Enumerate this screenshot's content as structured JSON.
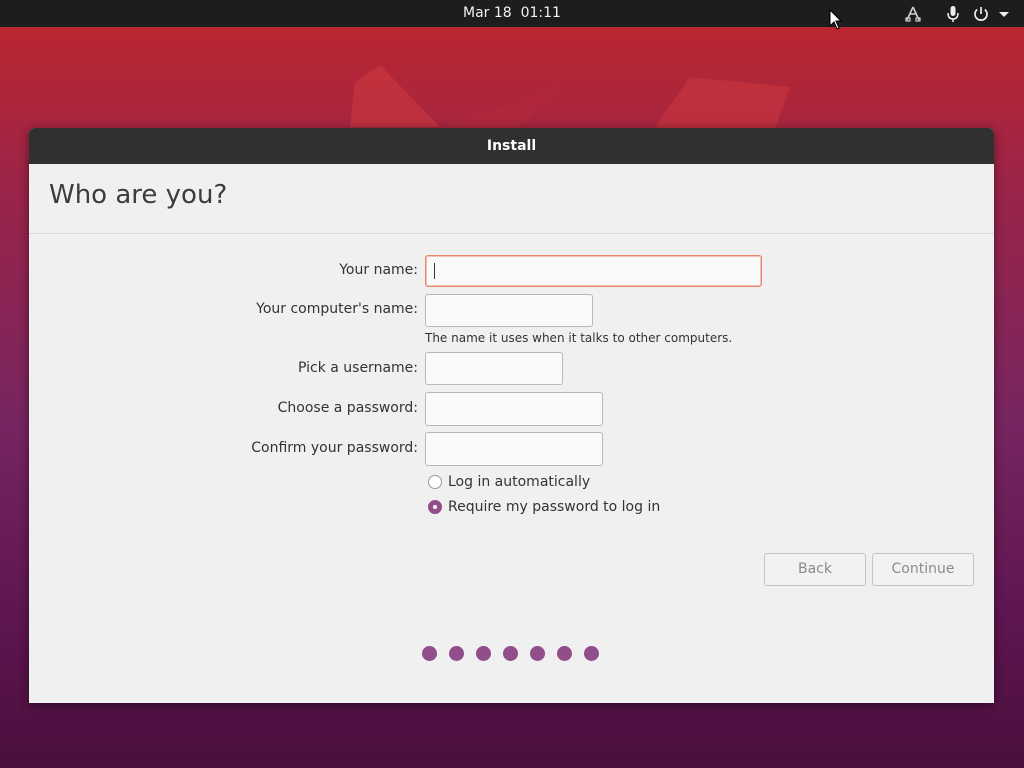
{
  "topbar": {
    "date": "Mar 18",
    "time": "01:11",
    "icons": [
      "network-icon",
      "microphone-icon",
      "power-icon",
      "chevron-down-icon"
    ]
  },
  "window": {
    "title": "Install",
    "heading": "Who are you?"
  },
  "form": {
    "your_name_label": "Your name:",
    "your_name_value": "",
    "computer_name_label": "Your computer's name:",
    "computer_name_value": "",
    "computer_name_hint": "The name it uses when it talks to other computers.",
    "username_label": "Pick a username:",
    "username_value": "",
    "password_label": "Choose a password:",
    "password_value": "",
    "confirm_label": "Confirm your password:",
    "confirm_value": "",
    "login_options": [
      {
        "label": "Log in automatically",
        "checked": false
      },
      {
        "label": "Require my password to log in",
        "checked": true
      }
    ]
  },
  "buttons": {
    "back": "Back",
    "continue": "Continue"
  },
  "progress": {
    "steps": 7,
    "accent": "#924d8b"
  },
  "colors": {
    "titlebar": "#303030",
    "topbar": "#1d1d1d",
    "focus_border": "#e9856b"
  }
}
